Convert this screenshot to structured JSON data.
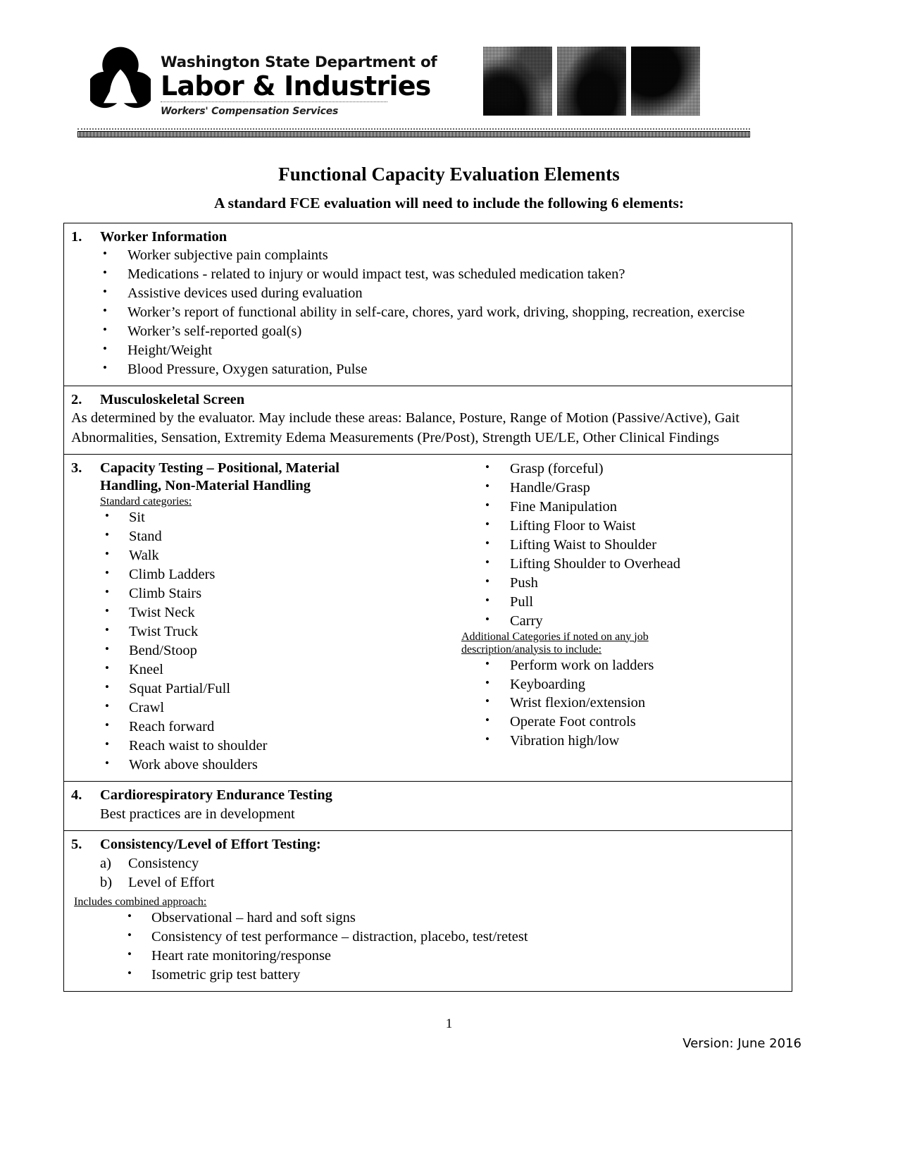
{
  "header": {
    "logo": {
      "line1": "Washington State Department of",
      "line2": "Labor & Industries",
      "line3": "Workers' Compensation Services",
      "mark_name": "li-trillium-logo"
    },
    "photos": [
      "worker-photo-1",
      "worker-photo-2",
      "worker-photo-3"
    ]
  },
  "title": "Functional Capacity Evaluation Elements",
  "subtitle": "A standard FCE evaluation will need to include the following 6 elements:",
  "sections": {
    "s1": {
      "number": "1.",
      "title": "Worker Information",
      "bullets": [
        "Worker subjective pain complaints",
        "Medications - related to injury or would impact test, was scheduled medication taken?",
        "Assistive devices used during evaluation",
        "Worker’s report of functional ability in self-care, chores, yard work, driving, shopping, recreation, exercise",
        "Worker’s self-reported goal(s)",
        "Height/Weight",
        "Blood Pressure, Oxygen saturation, Pulse"
      ]
    },
    "s2": {
      "number": "2.",
      "title": "Musculoskeletal Screen",
      "body": "As determined by the evaluator.  May include these areas: Balance, Posture, Range of Motion (Passive/Active), Gait Abnormalities, Sensation, Extremity Edema Measurements (Pre/Post), Strength UE/LE, Other Clinical Findings"
    },
    "s3": {
      "number": "3.",
      "title_line1": "Capacity Testing – Positional, Material",
      "title_line2": "Handling, Non-Material Handling",
      "standard_label": "Standard categories:",
      "left_bullets": [
        "Sit",
        "Stand",
        "Walk",
        "Climb Ladders",
        "Climb Stairs",
        "Twist Neck",
        "Twist Truck",
        "Bend/Stoop",
        "Kneel",
        "Squat Partial/Full",
        "Crawl",
        "Reach forward",
        "Reach waist to shoulder",
        "Work above shoulders"
      ],
      "right_bullets": [
        "Grasp (forceful)",
        "Handle/Grasp",
        "Fine Manipulation",
        "Lifting Floor to Waist",
        "Lifting Waist to Shoulder",
        "Lifting Shoulder to Overhead",
        "Push",
        "Pull",
        "Carry"
      ],
      "additional_label_line1": "Additional Categories if noted on any job",
      "additional_label_line2": "description/analysis to include:",
      "additional_bullets": [
        "Perform work on ladders",
        "Keyboarding",
        "Wrist flexion/extension",
        "Operate Foot controls",
        "Vibration high/low"
      ]
    },
    "s4": {
      "number": "4.",
      "title": "Cardiorespiratory Endurance Testing",
      "body": "Best practices are in development"
    },
    "s5": {
      "number": "5.",
      "title": "Consistency/Level of Effort Testing:",
      "items": [
        {
          "marker": "a)",
          "text": "Consistency"
        },
        {
          "marker": "b)",
          "text": "Level of Effort"
        }
      ],
      "includes_label": "Includes combined approach:",
      "bullets": [
        "Observational – hard and soft signs",
        "Consistency of test performance – distraction, placebo, test/retest",
        "Heart rate monitoring/response",
        "Isometric grip test battery"
      ]
    }
  },
  "footer": {
    "page_number": "1",
    "version": "Version: June 2016"
  }
}
